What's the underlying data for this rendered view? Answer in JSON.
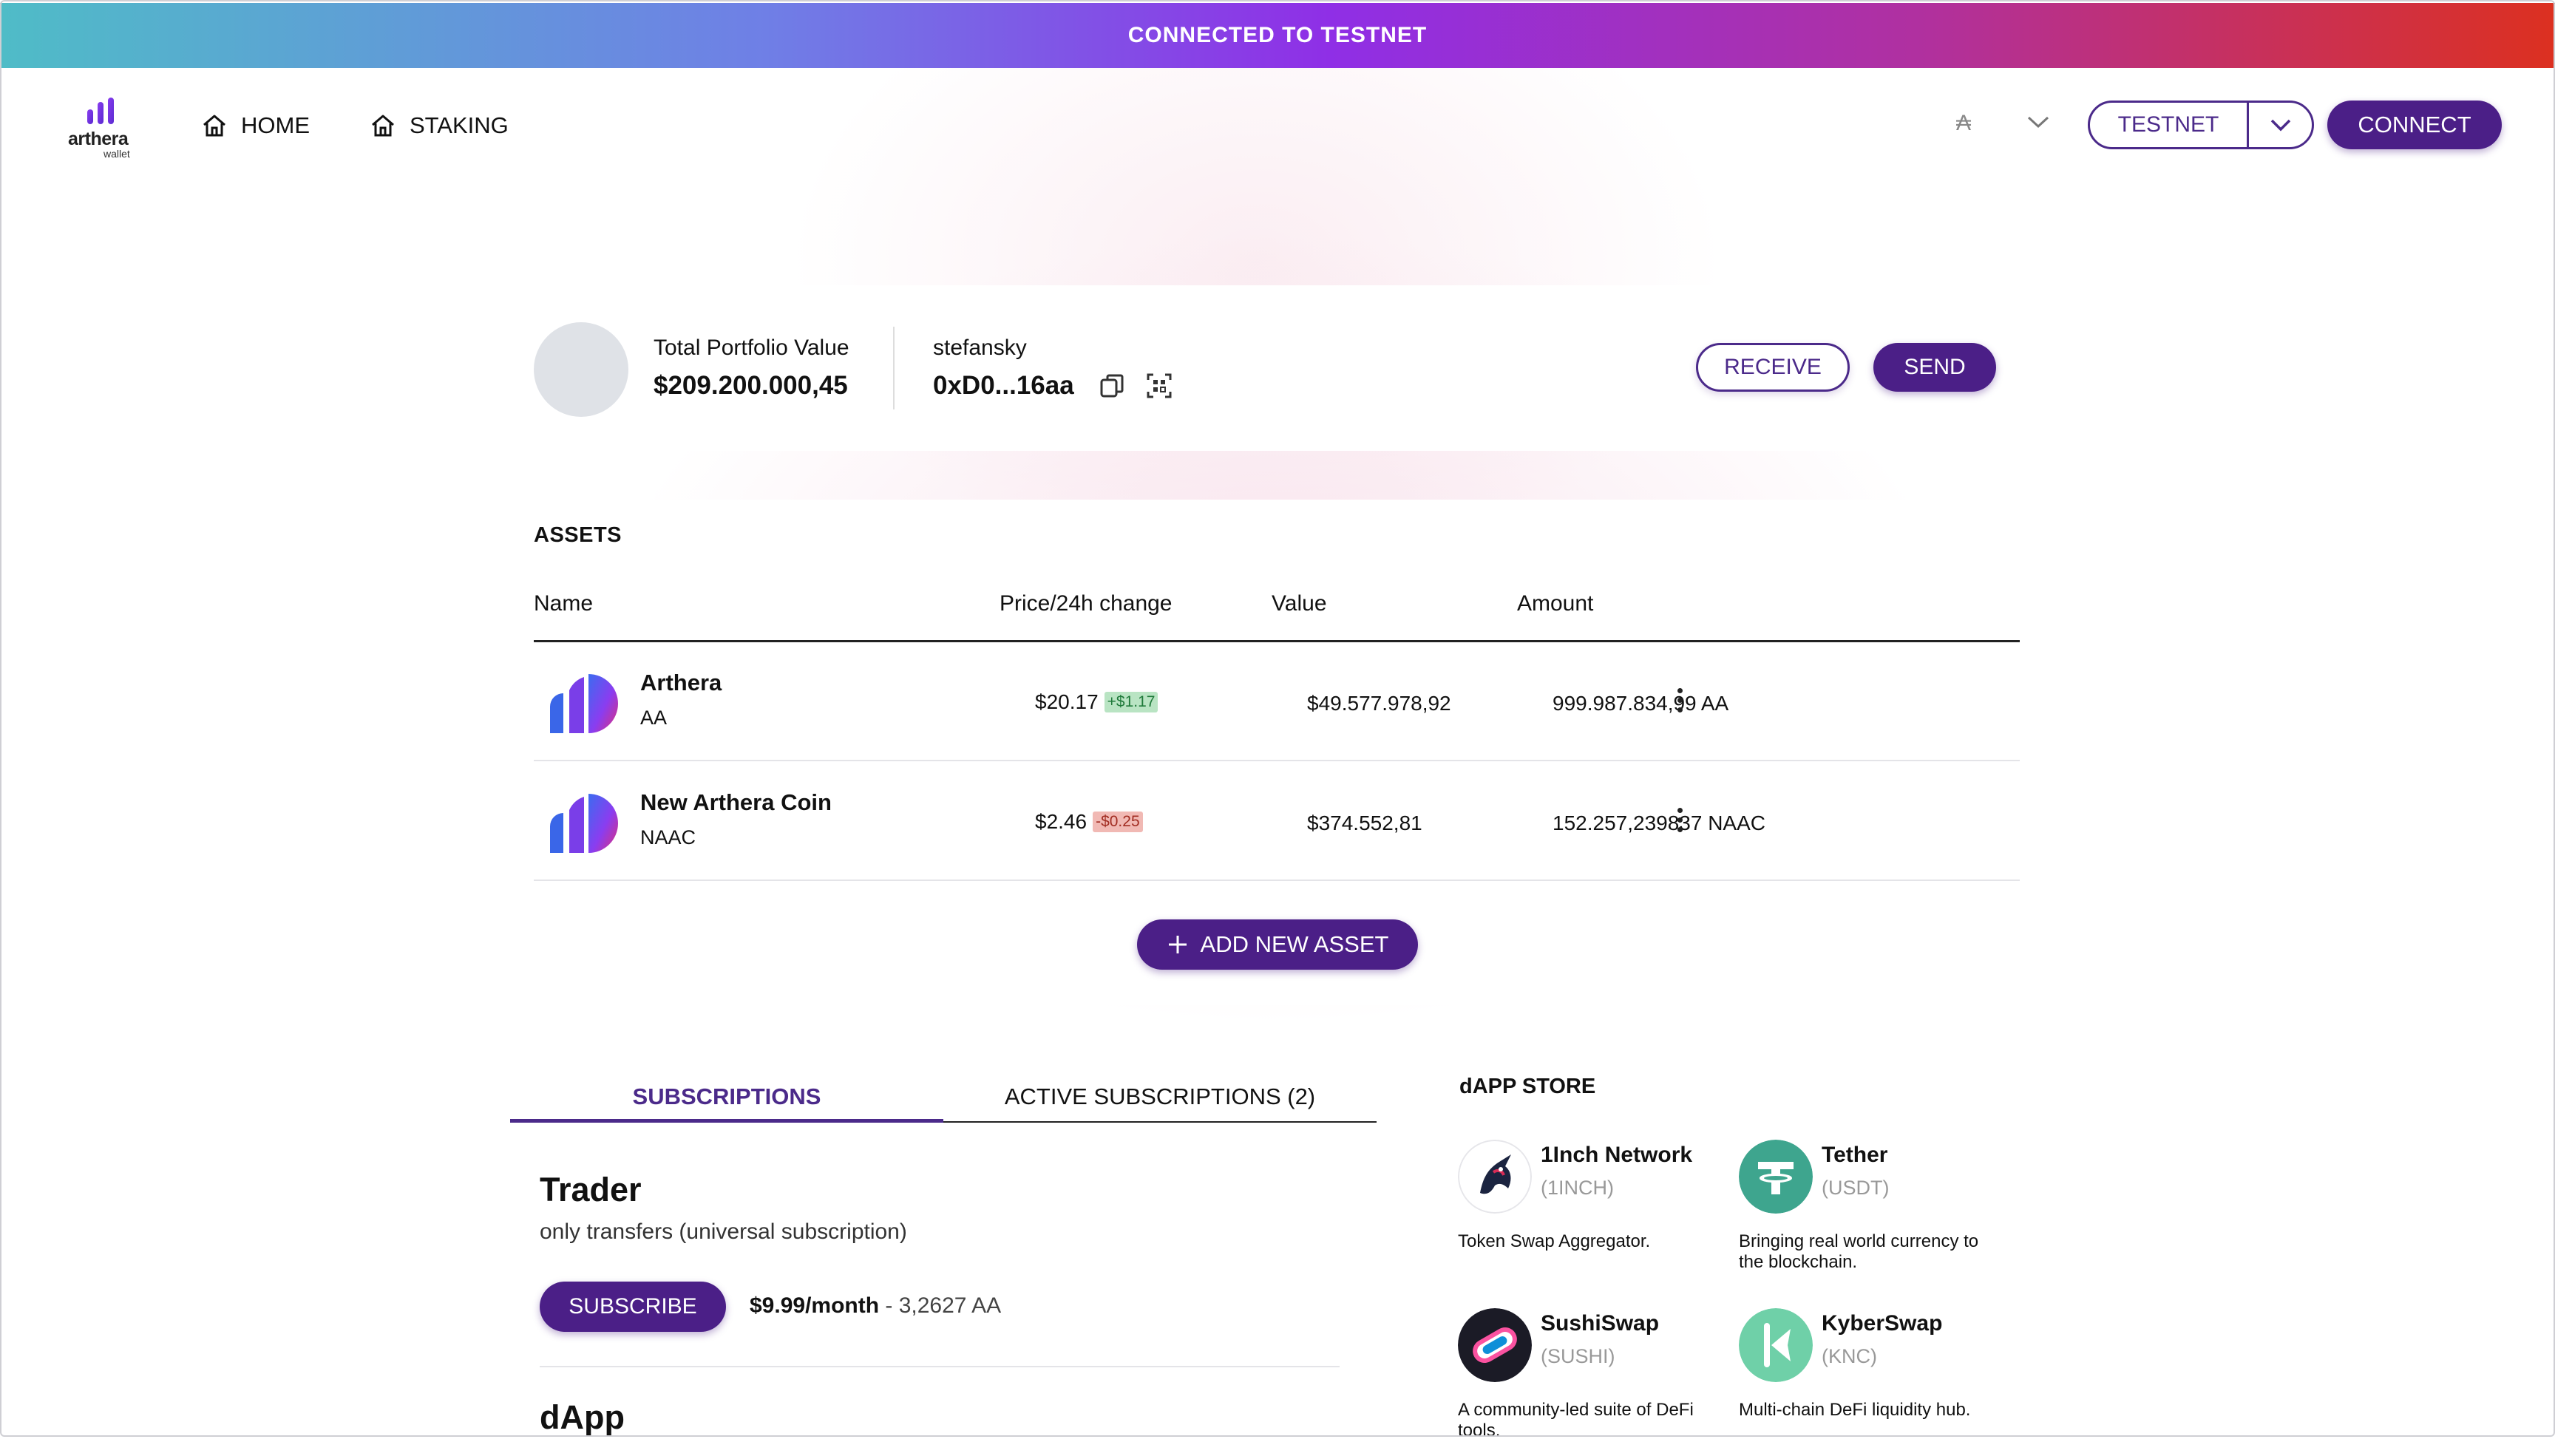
{
  "banner": {
    "text": "CONNECTED TO TESTNET"
  },
  "logo": {
    "word": "arthera",
    "sub": "wallet"
  },
  "nav": [
    {
      "label": "HOME",
      "icon": "home-icon"
    },
    {
      "label": "STAKING",
      "icon": "home-icon"
    }
  ],
  "header": {
    "token_glyph": "₳",
    "network_label": "TESTNET",
    "connect_label": "CONNECT"
  },
  "portfolio": {
    "total_label": "Total Portfolio Value",
    "total_value": "$209.200.000,45",
    "account_name": "stefansky",
    "address": "0xD0...16aa",
    "receive_label": "RECEIVE",
    "send_label": "SEND"
  },
  "assets": {
    "title": "ASSETS",
    "columns": [
      "Name",
      "Price/24h change",
      "Value",
      "Amount"
    ],
    "rows": [
      {
        "name": "Arthera",
        "symbol": "AA",
        "price": "$20.17",
        "change": "+$1.17",
        "change_dir": "up",
        "value": "$49.577.978,92",
        "amount": "999.987.834,99 AA"
      },
      {
        "name": "New Arthera Coin",
        "symbol": "NAAC",
        "price": "$2.46",
        "change": "-$0.25",
        "change_dir": "down",
        "value": "$374.552,81",
        "amount": "152.257,239837 NAAC"
      }
    ],
    "add_label": "ADD NEW ASSET"
  },
  "subscriptions": {
    "tabs": [
      "SUBSCRIPTIONS",
      "ACTIVE SUBSCRIPTIONS (2)"
    ],
    "plan": {
      "title": "Trader",
      "description": "only transfers (universal subscription)",
      "subscribe_label": "SUBSCRIBE",
      "price": "$9.99/month",
      "price_suffix": " - 3,2627 AA"
    },
    "next_plan_title": "dApp"
  },
  "store": {
    "title": "dAPP STORE",
    "items": [
      {
        "name": "1Inch Network",
        "ticker": "(1INCH)",
        "description": "Token Swap Aggregator."
      },
      {
        "name": "Tether",
        "ticker": "(USDT)",
        "description": "Bringing real world currency to the blockchain."
      },
      {
        "name": "SushiSwap",
        "ticker": "(SUSHI)",
        "description": "A community-led suite of DeFi tools."
      },
      {
        "name": "KyberSwap",
        "ticker": "(KNC)",
        "description": "Multi-chain DeFi liquidity hub."
      }
    ]
  },
  "colors": {
    "accent": "#4b1f87",
    "positive": "#1f7a3a",
    "negative": "#a22d22"
  }
}
